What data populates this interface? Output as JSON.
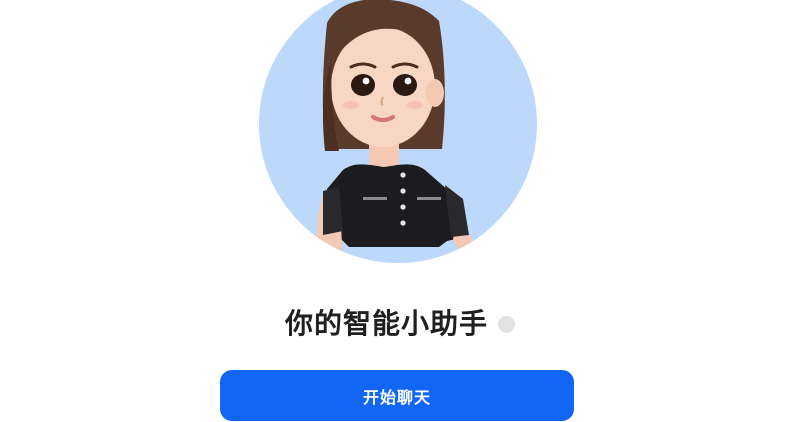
{
  "assistant": {
    "avatar_icon": "female-cartoon-avatar",
    "title": "你的智能小助手",
    "status_icon": "status-dot-icon"
  },
  "actions": {
    "start_chat_label": "开始聊天"
  },
  "colors": {
    "avatar_background": "#bcd9fb",
    "status_dot": "#e3e3e3",
    "primary_button": "#1266f5",
    "title_text": "#1f1f1f"
  }
}
